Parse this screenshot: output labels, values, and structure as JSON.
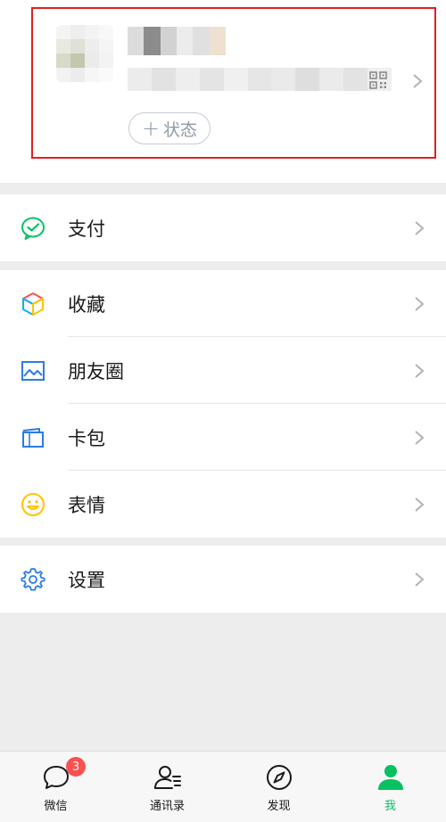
{
  "profile": {
    "status_label": "状态",
    "status_plus": "+",
    "highlight_color": "#e02020"
  },
  "menu": {
    "pay": {
      "label": "支付",
      "icon": "wechat-pay-icon"
    },
    "favorites": {
      "label": "收藏",
      "icon": "favorites-cube-icon"
    },
    "moments": {
      "label": "朋友圈",
      "icon": "moments-photo-icon"
    },
    "cards": {
      "label": "卡包",
      "icon": "card-wallet-icon"
    },
    "stickers": {
      "label": "表情",
      "icon": "smiley-icon"
    },
    "settings": {
      "label": "设置",
      "icon": "gear-icon"
    }
  },
  "tabbar": {
    "tabs": [
      {
        "label": "微信",
        "icon": "chat-bubble-icon",
        "badge": "3",
        "active": false
      },
      {
        "label": "通讯录",
        "icon": "contacts-icon",
        "active": false
      },
      {
        "label": "发现",
        "icon": "compass-icon",
        "active": false
      },
      {
        "label": "我",
        "icon": "person-icon",
        "active": true
      }
    ]
  },
  "colors": {
    "accent": "#07c160",
    "badge": "#fa5151",
    "background": "#ededed"
  }
}
